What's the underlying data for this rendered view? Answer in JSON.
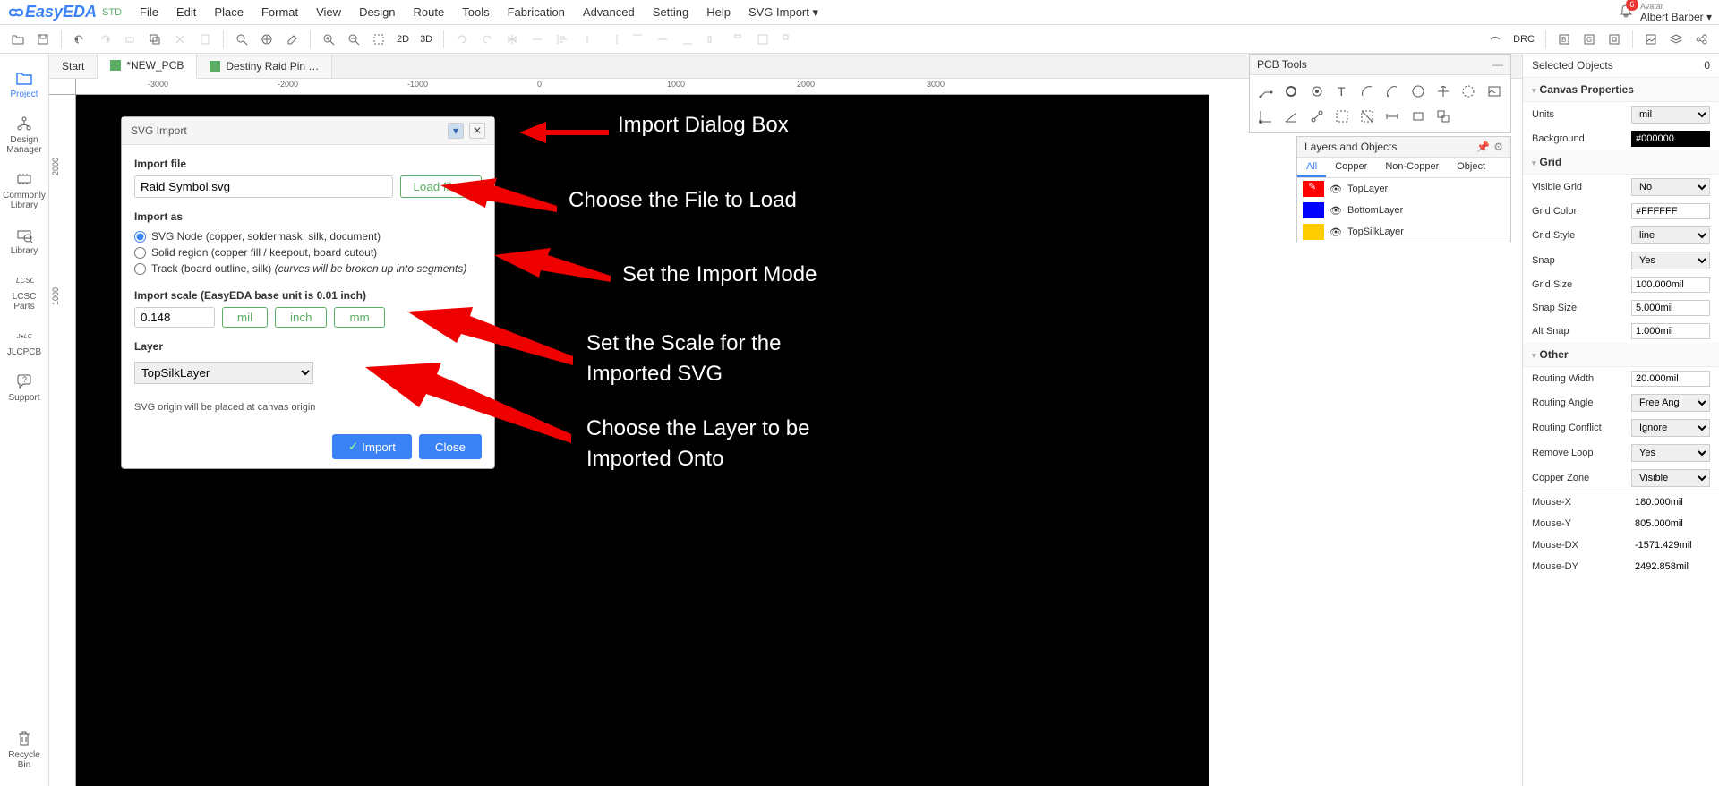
{
  "app": {
    "logo": "EasyEDA",
    "edition": "STD"
  },
  "menu": [
    "File",
    "Edit",
    "Place",
    "Format",
    "View",
    "Design",
    "Route",
    "Tools",
    "Fabrication",
    "Advanced",
    "Setting",
    "Help",
    "SVG Import ▾"
  ],
  "user": {
    "avatar_label": "Avatar",
    "name": "Albert Barber ▾",
    "badge": "6"
  },
  "toolbar": {
    "d2": "2D",
    "d3": "3D",
    "drc": "DRC"
  },
  "tabs": [
    {
      "label": "Start",
      "icon": false
    },
    {
      "label": "*NEW_PCB",
      "icon": true,
      "active": true
    },
    {
      "label": "Destiny Raid Pin …",
      "icon": true
    }
  ],
  "sidebar": [
    {
      "label": "Project",
      "active": true
    },
    {
      "label": "Design\nManager"
    },
    {
      "label": "Commonly\nLibrary"
    },
    {
      "label": "Library"
    },
    {
      "label": "LCSC\nParts"
    },
    {
      "label": "JLCPCB"
    },
    {
      "label": "Support"
    },
    {
      "label": "Recycle\nBin"
    }
  ],
  "ruler_h": [
    "-3000",
    "-2000",
    "-1000",
    "0",
    "1000",
    "2000",
    "3000"
  ],
  "ruler_v": [
    "2000",
    "1000"
  ],
  "dialog": {
    "title": "SVG Import",
    "import_file_label": "Import file",
    "file_value": "Raid Symbol.svg",
    "load_btn": "Load file...",
    "import_as_label": "Import as",
    "opt1": "SVG Node (copper, soldermask, silk, document)",
    "opt2": "Solid region (copper fill / keepout, board cutout)",
    "opt3a": "Track (board outline, silk) ",
    "opt3b": "(curves will be broken up into segments)",
    "scale_label": "Import scale (EasyEDA base unit is 0.01 inch)",
    "scale_value": "0.148",
    "units": [
      "mil",
      "inch",
      "mm"
    ],
    "layer_label": "Layer",
    "layer_value": "TopSilkLayer",
    "origin_note": "SVG origin will be placed at canvas origin",
    "import_btn": "Import",
    "close_btn": "Close"
  },
  "annotations": {
    "a1": "Import Dialog Box",
    "a2": "Choose the File to Load",
    "a3": "Set the Import Mode",
    "a4a": "Set the Scale for the",
    "a4b": "Imported SVG",
    "a5a": "Choose the Layer to be",
    "a5b": "Imported Onto"
  },
  "pcb_tools": {
    "title": "PCB Tools"
  },
  "layers": {
    "title": "Layers and Objects",
    "tabs": [
      "All",
      "Copper",
      "Non-Copper",
      "Object"
    ],
    "rows": [
      {
        "swatch": "red",
        "name": "TopLayer"
      },
      {
        "swatch": "blue",
        "name": "BottomLayer"
      },
      {
        "swatch": "yellow",
        "name": "TopSilkLayer"
      }
    ]
  },
  "props": {
    "selected_label": "Selected Objects",
    "selected_count": "0",
    "canvas_title": "Canvas Properties",
    "units_lbl": "Units",
    "units_val": "mil",
    "bg_lbl": "Background",
    "bg_val": "#000000",
    "grid_title": "Grid",
    "vg_lbl": "Visible Grid",
    "vg_val": "No",
    "gc_lbl": "Grid Color",
    "gc_val": "#FFFFFF",
    "gs_lbl": "Grid Style",
    "gs_val": "line",
    "snap_lbl": "Snap",
    "snap_val": "Yes",
    "gsize_lbl": "Grid Size",
    "gsize_val": "100.000mil",
    "ssize_lbl": "Snap Size",
    "ssize_val": "5.000mil",
    "asnap_lbl": "Alt Snap",
    "asnap_val": "1.000mil",
    "other_title": "Other",
    "rw_lbl": "Routing Width",
    "rw_val": "20.000mil",
    "ra_lbl": "Routing Angle",
    "ra_val": "Free Ang",
    "rc_lbl": "Routing Conflict",
    "rc_val": "Ignore",
    "rl_lbl": "Remove Loop",
    "rl_val": "Yes",
    "cz_lbl": "Copper Zone",
    "cz_val": "Visible",
    "mx_lbl": "Mouse-X",
    "mx_val": "180.000mil",
    "my_lbl": "Mouse-Y",
    "my_val": "805.000mil",
    "mdx_lbl": "Mouse-DX",
    "mdx_val": "-1571.429mil",
    "mdy_lbl": "Mouse-DY",
    "mdy_val": "2492.858mil"
  }
}
